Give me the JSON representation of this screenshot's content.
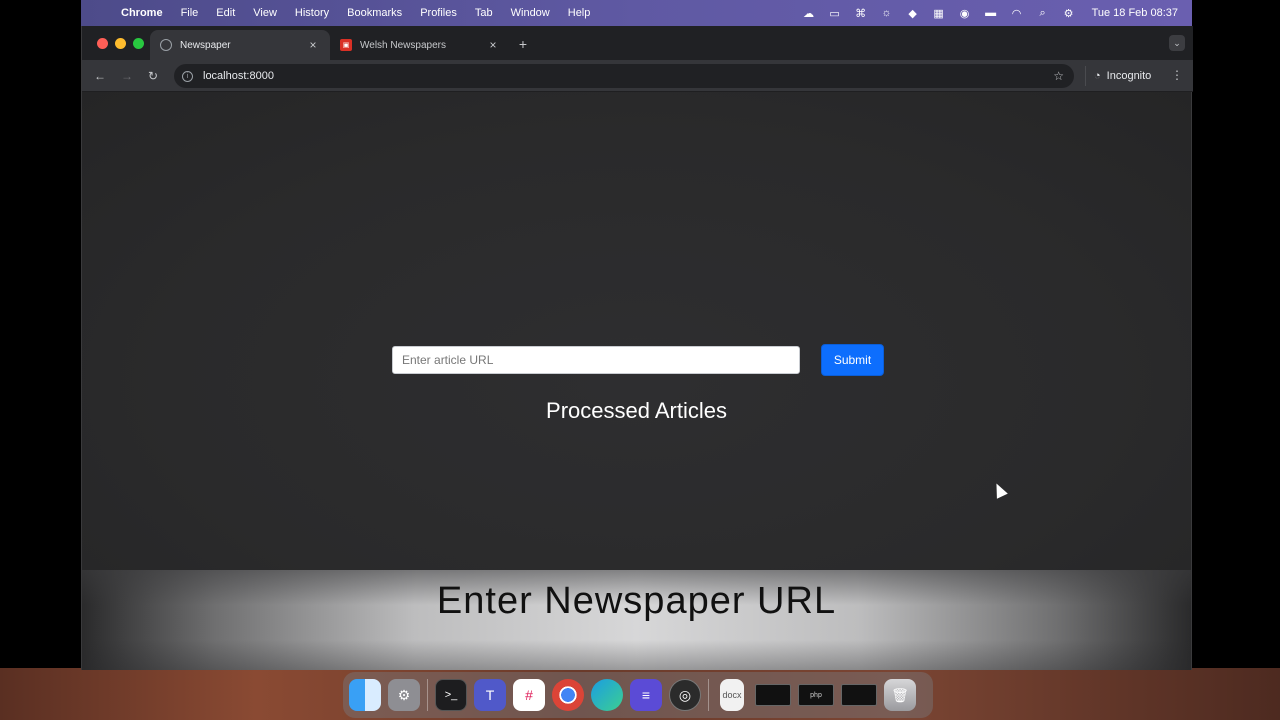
{
  "menubar": {
    "apple": "",
    "items": [
      "Chrome",
      "File",
      "Edit",
      "View",
      "History",
      "Bookmarks",
      "Profiles",
      "Tab",
      "Window",
      "Help"
    ],
    "clock": "Tue 18 Feb  08:37"
  },
  "browser": {
    "tabs": [
      {
        "title": "Newspaper",
        "icon": "globe-icon",
        "active": true
      },
      {
        "title": "Welsh Newspapers",
        "icon": "red-favicon",
        "active": false
      }
    ],
    "address": "localhost:8000",
    "profile": "Incognito"
  },
  "page": {
    "url_placeholder": "Enter article URL",
    "submit_label": "Submit",
    "section_title": "Processed Articles",
    "caption": "Enter Newspaper URL"
  },
  "colors": {
    "accent": "#0d6efd",
    "page_bg": "#2b2b2c"
  },
  "dock": {
    "doc_label": "docx",
    "thumb_label": "php"
  }
}
